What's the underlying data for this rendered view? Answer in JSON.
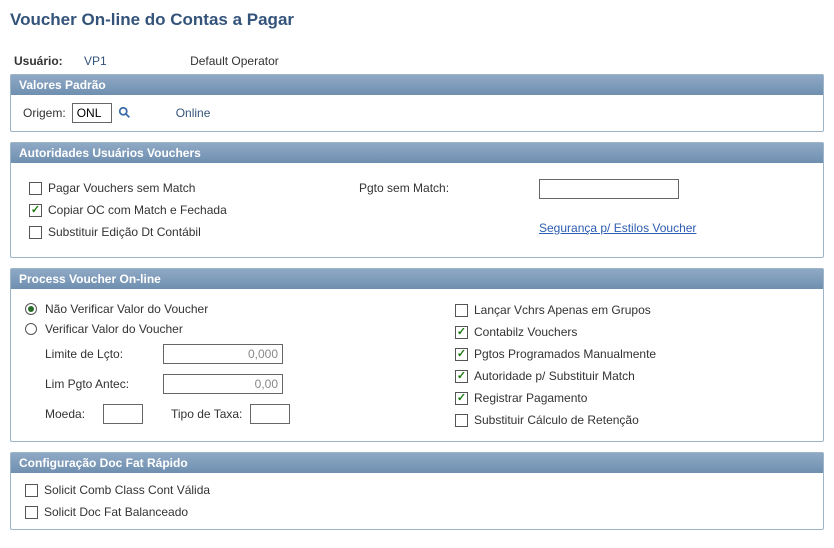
{
  "title": "Voucher On-line do Contas a Pagar",
  "user": {
    "label": "Usuário:",
    "id": "VP1",
    "operator": "Default Operator"
  },
  "sections": {
    "valores_padrao": {
      "header": "Valores Padrão",
      "origin_label": "Origem:",
      "origin_value": "ONL",
      "origin_desc": "Online"
    },
    "autoridades": {
      "header": "Autoridades Usuários Vouchers",
      "checkboxes": {
        "pagar_sem_match": {
          "label": "Pagar Vouchers sem Match",
          "checked": false
        },
        "copiar_oc": {
          "label": "Copiar OC com Match e Fechada",
          "checked": true
        },
        "sub_edicao": {
          "label": "Substituir Edição Dt Contábil",
          "checked": false
        }
      },
      "pgto_sem_match_label": "Pgto sem Match:",
      "pgto_sem_match_value": "",
      "link": "Segurança p/ Estilos Voucher"
    },
    "process": {
      "header": "Process Voucher On-line",
      "radios": {
        "nao_verificar": {
          "label": "Não Verificar Valor do Voucher",
          "selected": true
        },
        "verificar": {
          "label": "Verificar Valor do Voucher",
          "selected": false
        }
      },
      "fields": {
        "limite_lcto": {
          "label": "Limite de Lçto:",
          "value": "0,000"
        },
        "lim_pgto_antec": {
          "label": "Lim Pgto Antec:",
          "value": "0,00"
        },
        "moeda": {
          "label": "Moeda:",
          "value": ""
        },
        "tipo_taxa": {
          "label": "Tipo de Taxa:",
          "value": ""
        }
      },
      "right_checks": {
        "lancar_grupos": {
          "label": "Lançar Vchrs Apenas em Grupos",
          "checked": false
        },
        "contabilz": {
          "label": "Contabilz Vouchers",
          "checked": true
        },
        "pgtos_prog": {
          "label": "Pgtos Programados Manualmente",
          "checked": true
        },
        "autoridade_sub": {
          "label": "Autoridade p/ Substituir Match",
          "checked": true
        },
        "registrar_pag": {
          "label": "Registrar Pagamento",
          "checked": true
        },
        "sub_calc_ret": {
          "label": "Substituir Cálculo de Retenção",
          "checked": false
        }
      }
    },
    "config_doc": {
      "header": "Configuração Doc Fat Rápido",
      "checks": {
        "solicit_comb": {
          "label": "Solicit Comb Class Cont Válida",
          "checked": false
        },
        "solicit_doc": {
          "label": "Solicit Doc Fat Balanceado",
          "checked": false
        }
      }
    }
  }
}
